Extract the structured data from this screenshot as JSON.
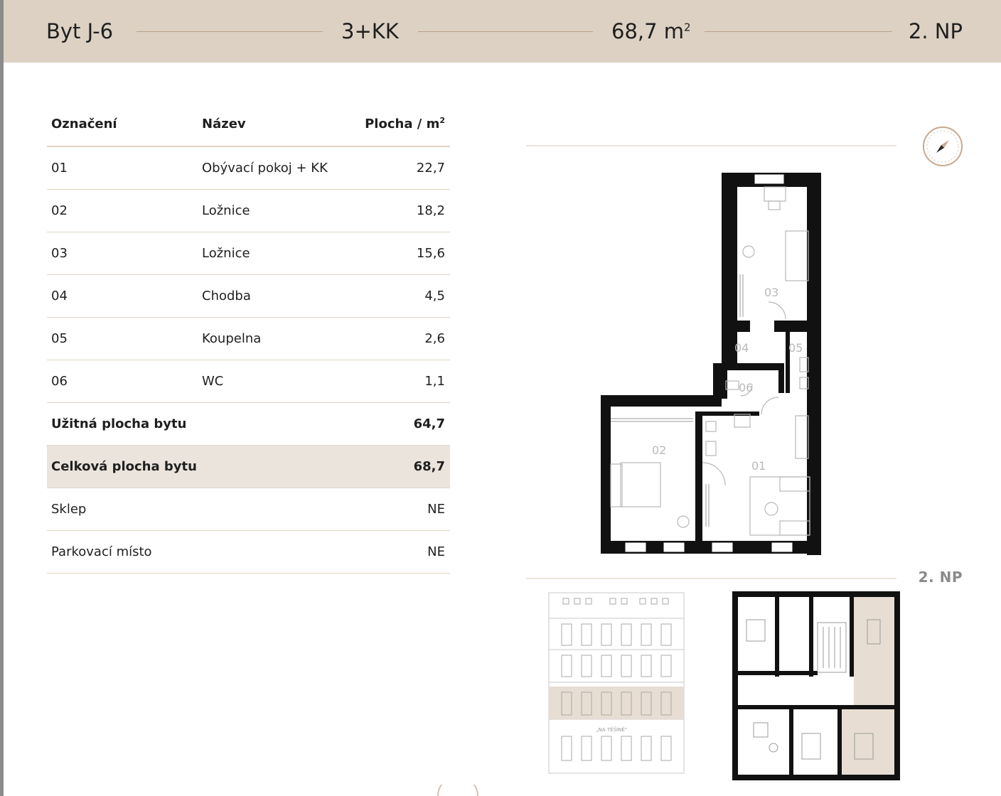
{
  "header": {
    "unit": "Byt J-6",
    "layout": "3+KK",
    "area": "68,7 m",
    "area_sup": "2",
    "floor": "2. NP"
  },
  "table": {
    "headers": {
      "col1": "Označení",
      "col2": "Název",
      "col3": "Plocha / m",
      "col3_sup": "2"
    },
    "rows": [
      {
        "id": "01",
        "name": "Obývací pokoj + KK",
        "area": "22,7"
      },
      {
        "id": "02",
        "name": "Ložnice",
        "area": "18,2"
      },
      {
        "id": "03",
        "name": "Ložnice",
        "area": "15,6"
      },
      {
        "id": "04",
        "name": "Chodba",
        "area": "4,5"
      },
      {
        "id": "05",
        "name": "Koupelna",
        "area": "2,6"
      },
      {
        "id": "06",
        "name": "WC",
        "area": "1,1"
      }
    ],
    "usable": {
      "label": "Užitná plocha bytu",
      "value": "64,7"
    },
    "total": {
      "label": "Celková plocha bytu",
      "value": "68,7"
    },
    "cellar": {
      "label": "Sklep",
      "value": "NE"
    },
    "parking": {
      "label": "Parkovací místo",
      "value": "NE"
    }
  },
  "plan": {
    "rooms": [
      "01",
      "02",
      "03",
      "04",
      "05",
      "06"
    ],
    "floor_label": "2. NP",
    "facade_sign": "„NA TĚŠÍNĚ\""
  },
  "icons": [
    "compass-icon"
  ],
  "colors": {
    "header_bg": "#dcd1c3",
    "accent": "#b79f89",
    "total_row_bg": "#ebe4dc",
    "highlight_floor": "#e7ddd2"
  }
}
